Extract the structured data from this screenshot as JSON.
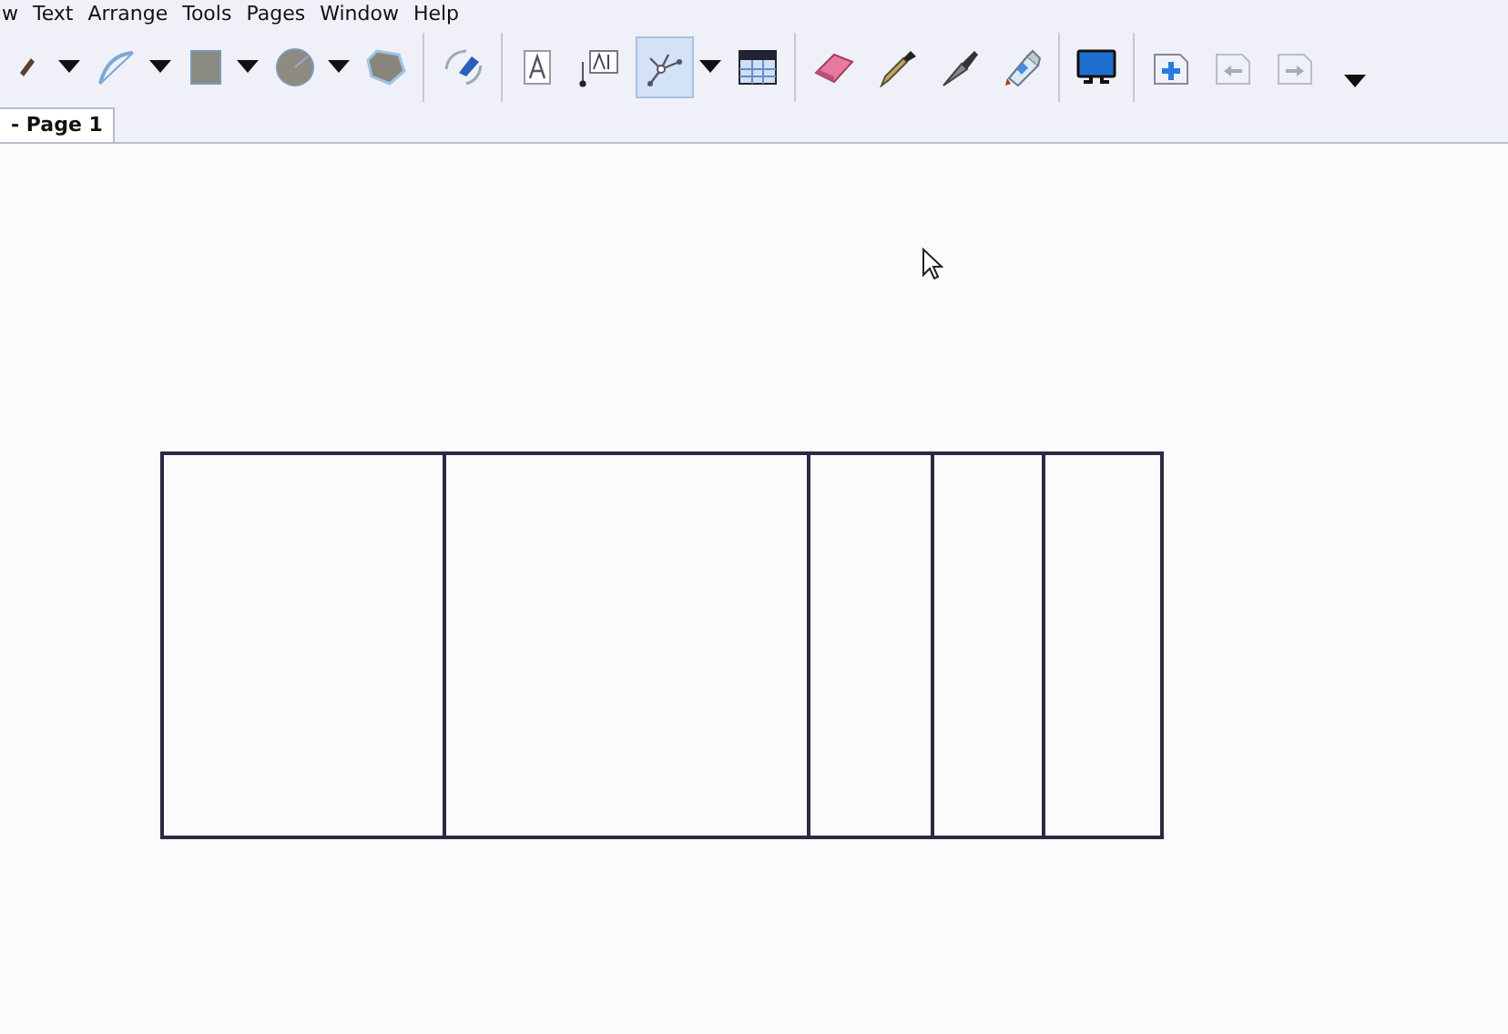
{
  "menu_bar": {
    "items": [
      "w",
      "Text",
      "Arrange",
      "Tools",
      "Pages",
      "Window",
      "Help"
    ]
  },
  "toolbar": {
    "groups": [
      [
        {
          "kind": "pen",
          "dropdown": true,
          "selected": false,
          "disabled": false
        },
        {
          "kind": "curve",
          "dropdown": true,
          "selected": false,
          "disabled": false
        },
        {
          "kind": "rectangle",
          "dropdown": true,
          "selected": false,
          "disabled": false
        },
        {
          "kind": "circle",
          "dropdown": true,
          "selected": false,
          "disabled": false
        },
        {
          "kind": "polygon",
          "dropdown": false,
          "selected": false,
          "disabled": false
        }
      ],
      [
        {
          "kind": "fill",
          "dropdown": false,
          "selected": false,
          "disabled": false
        }
      ],
      [
        {
          "kind": "text",
          "dropdown": false,
          "selected": false,
          "disabled": false
        },
        {
          "kind": "label",
          "dropdown": false,
          "selected": false,
          "disabled": false
        },
        {
          "kind": "connector",
          "dropdown": true,
          "selected": true,
          "disabled": false
        },
        {
          "kind": "table",
          "dropdown": false,
          "selected": false,
          "disabled": false
        }
      ],
      [
        {
          "kind": "eraser",
          "dropdown": false,
          "selected": false,
          "disabled": false
        },
        {
          "kind": "dropper",
          "dropdown": false,
          "selected": false,
          "disabled": false
        },
        {
          "kind": "knife",
          "dropdown": false,
          "selected": false,
          "disabled": false
        },
        {
          "kind": "glue",
          "dropdown": false,
          "selected": false,
          "disabled": false
        }
      ],
      [
        {
          "kind": "monitor",
          "dropdown": false,
          "selected": false,
          "disabled": false
        }
      ],
      [
        {
          "kind": "page-add",
          "dropdown": false,
          "selected": false,
          "disabled": false
        },
        {
          "kind": "page-prev",
          "dropdown": false,
          "selected": false,
          "disabled": true
        },
        {
          "kind": "page-next",
          "dropdown": false,
          "selected": false,
          "disabled": true
        },
        {
          "kind": "overflow",
          "dropdown": false,
          "selected": false,
          "disabled": false
        }
      ]
    ]
  },
  "tabs": [
    {
      "label": "- Page 1",
      "selected": true
    }
  ]
}
